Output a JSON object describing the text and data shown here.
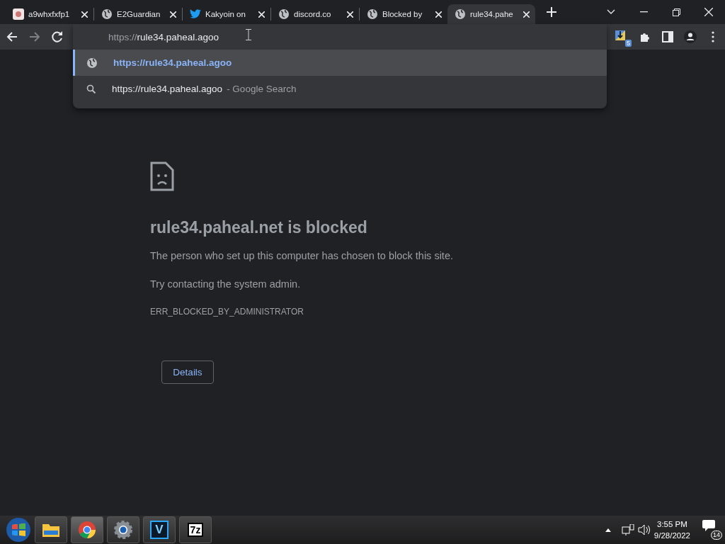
{
  "tabs": [
    {
      "title": "a9whxfxfp1",
      "kind": "site",
      "selected": false
    },
    {
      "title": "E2Guardian",
      "kind": "globe",
      "selected": false
    },
    {
      "title": "Kakyoin on",
      "kind": "bird",
      "selected": false
    },
    {
      "title": "discord.co",
      "kind": "globe",
      "selected": false
    },
    {
      "title": "Blocked by",
      "kind": "globe",
      "selected": false
    },
    {
      "title": "rule34.pahe",
      "kind": "globe",
      "selected": true
    }
  ],
  "omnibox": {
    "scheme": "https://",
    "host": "rule34.paheal.agoo"
  },
  "extension_badge": "5",
  "suggestions": [
    {
      "kind": "url",
      "text": "https://rule34.paheal.agoo",
      "selected": true
    },
    {
      "kind": "search",
      "text": "https://rule34.paheal.agoo",
      "suffix": "- Google Search",
      "selected": false
    }
  ],
  "error_page": {
    "heading": "rule34.paheal.net is blocked",
    "message": "The person who set up this computer has chosen to block this site.",
    "hint": "Try contacting the system admin.",
    "code": "ERR_BLOCKED_BY_ADMINISTRATOR",
    "button": "Details"
  },
  "taskbar": {
    "apps": [
      {
        "kind": "folder"
      },
      {
        "kind": "chrome",
        "selected": true
      },
      {
        "kind": "gear",
        "selected": false
      },
      {
        "kind": "v",
        "label": "V"
      },
      {
        "kind": "zip",
        "label": "7z"
      }
    ],
    "time": "3:55 PM",
    "date": "9/28/2022",
    "notifications": "14"
  }
}
